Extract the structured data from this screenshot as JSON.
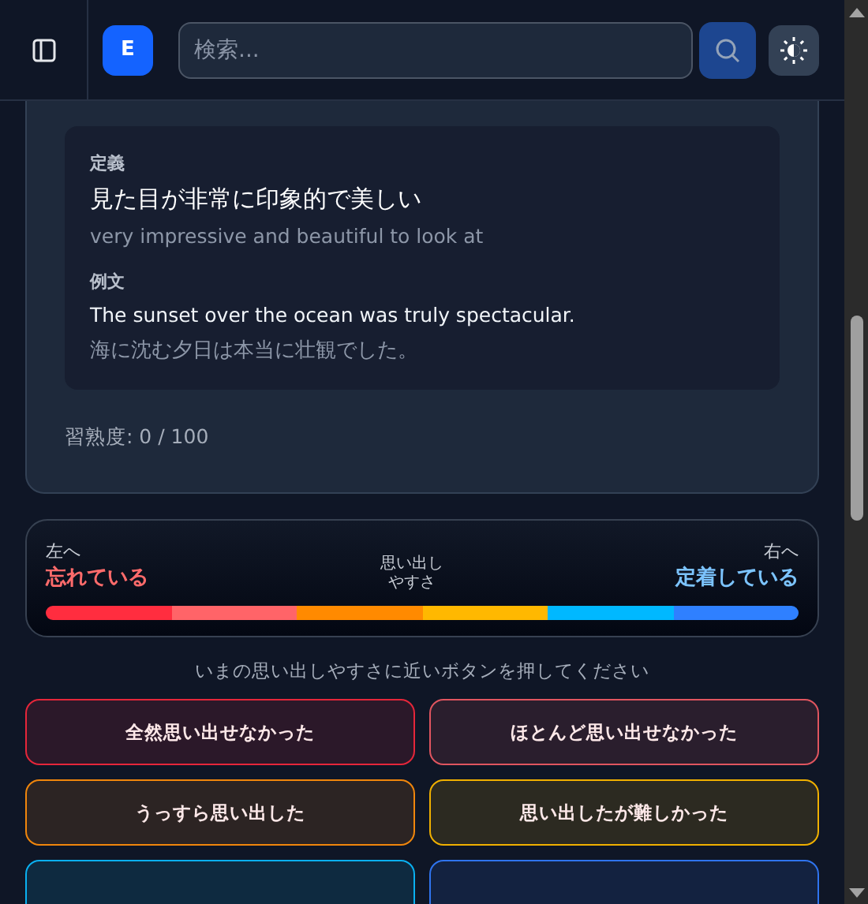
{
  "header": {
    "logo": "E",
    "search": {
      "placeholder": "検索..."
    }
  },
  "definition": {
    "label": "定義",
    "meaning": "見た目が非常に印象的で美しい",
    "english": "very impressive and beautiful to look at",
    "example_label": "例文",
    "example": "The sunset over the ocean was truly spectacular.",
    "example_translation": "海に沈む夕日は本当に壮観でした。"
  },
  "mastery": "習熟度: 0 / 100",
  "scale": {
    "left_hint": "左へ",
    "left_label": "忘れている",
    "center_label": [
      "思い出し",
      "やすさ"
    ],
    "right_hint": "右へ",
    "right_label": "定着している",
    "segments": [
      {
        "color": "#ff2d3f"
      },
      {
        "color": "#ff6468"
      },
      {
        "color": "#ff8a00"
      },
      {
        "color": "#ffb800"
      },
      {
        "color": "#00b8ff"
      },
      {
        "color": "#2f80ff"
      }
    ]
  },
  "instruction": "いまの思い出しやすさに近いボタンを押してください",
  "answers": [
    {
      "label": "全然思い出せなかった",
      "color": "#e5263a"
    },
    {
      "label": "ほとんど思い出せなかった",
      "color": "#e0555f"
    },
    {
      "label": "うっすら思い出した",
      "color": "#f0860c"
    },
    {
      "label": "思い出したが難しかった",
      "color": "#f0b000"
    },
    {
      "color": "#0ab0f0"
    },
    {
      "color": "#2f74ee"
    }
  ]
}
